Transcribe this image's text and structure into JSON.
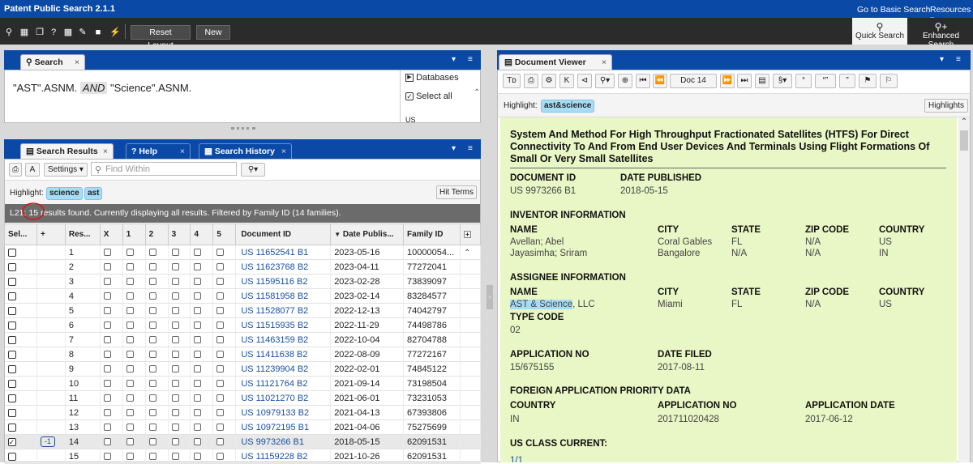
{
  "app": {
    "title": "Patent Public Search 2.1.1",
    "links": [
      "Go to Basic Search",
      "Resources ▾"
    ]
  },
  "toolbar": {
    "reset_layout": "Reset Layout",
    "new": "New",
    "quick_search": "Quick Search",
    "enhanced_search": "Enhanced Search"
  },
  "search_pane": {
    "tab": "Search",
    "query_parts": [
      "\"AST\".ASNM.",
      "AND",
      "\"Science\".ASNM."
    ],
    "databases": "Databases",
    "select_all": "Select all",
    "us": "US"
  },
  "results_pane": {
    "tabs": [
      "Search Results",
      "Help",
      "Search History"
    ],
    "settings": "Settings",
    "find_placeholder": "Find Within",
    "highlight_label": "Highlight:",
    "highlight_terms": [
      "science",
      "ast"
    ],
    "hit_terms": "Hit Terms",
    "status": "L21: 15 results found. Currently displaying all results. Filtered by Family ID (14 families).",
    "columns": [
      "Sel...",
      "+",
      "Res...",
      "X",
      "1",
      "2",
      "3",
      "4",
      "5",
      "Document ID",
      "Date Publis...",
      "Family ID"
    ],
    "rows": [
      {
        "n": "1",
        "doc": "US 11652541 B1",
        "date": "2023-05-16",
        "family": "10000054..."
      },
      {
        "n": "2",
        "doc": "US 11623768 B2",
        "date": "2023-04-11",
        "family": "77272041"
      },
      {
        "n": "3",
        "doc": "US 11595116 B2",
        "date": "2023-02-28",
        "family": "73839097"
      },
      {
        "n": "4",
        "doc": "US 11581958 B2",
        "date": "2023-02-14",
        "family": "83284577"
      },
      {
        "n": "5",
        "doc": "US 11528077 B2",
        "date": "2022-12-13",
        "family": "74042797"
      },
      {
        "n": "6",
        "doc": "US 11515935 B2",
        "date": "2022-11-29",
        "family": "74498786"
      },
      {
        "n": "7",
        "doc": "US 11463159 B2",
        "date": "2022-10-04",
        "family": "82704788"
      },
      {
        "n": "8",
        "doc": "US 11411638 B2",
        "date": "2022-08-09",
        "family": "77272167"
      },
      {
        "n": "9",
        "doc": "US 11239904 B2",
        "date": "2022-02-01",
        "family": "74845122"
      },
      {
        "n": "10",
        "doc": "US 11121764 B2",
        "date": "2021-09-14",
        "family": "73198504"
      },
      {
        "n": "11",
        "doc": "US 11021270 B2",
        "date": "2021-06-01",
        "family": "73231053"
      },
      {
        "n": "12",
        "doc": "US 10979133 B2",
        "date": "2021-04-13",
        "family": "67393806"
      },
      {
        "n": "13",
        "doc": "US 10972195 B1",
        "date": "2021-04-06",
        "family": "75275699"
      },
      {
        "n": "14",
        "doc": "US 9973266 B1",
        "date": "2018-05-15",
        "family": "62091531",
        "badge": "-1"
      },
      {
        "n": "15",
        "doc": "US 11159228 B2",
        "date": "2021-10-26",
        "family": "62091531"
      }
    ]
  },
  "viewer": {
    "tab": "Document Viewer",
    "doc_nav": "Doc 14",
    "highlight_label": "Highlight:",
    "highlight_term": "ast&science",
    "highlights_btn": "Highlights",
    "title": "System And Method For High Throughput Fractionated Satellites (HTFS) For Direct Connectivity To And From End User Devices And Terminals Using Flight Formations Of Small Or Very Small Satellites",
    "document_id_label": "DOCUMENT ID",
    "document_id": "US 9973266 B1",
    "date_published_label": "DATE PUBLISHED",
    "date_published": "2018-05-15",
    "inventor_heading": "INVENTOR INFORMATION",
    "col_name": "NAME",
    "col_city": "CITY",
    "col_state": "STATE",
    "col_zip": "ZIP CODE",
    "col_country": "COUNTRY",
    "inventors": [
      {
        "name": "Avellan; Abel",
        "city": "Coral Gables",
        "state": "FL",
        "zip": "N/A",
        "country": "US"
      },
      {
        "name": "Jayasimha; Sriram",
        "city": "Bangalore",
        "state": "N/A",
        "zip": "N/A",
        "country": "IN"
      }
    ],
    "assignee_heading": "ASSIGNEE INFORMATION",
    "assignee_name_hl": "AST & Science",
    "assignee_name_rest": ", LLC",
    "assignee_city": "Miami",
    "assignee_state": "FL",
    "assignee_zip": "N/A",
    "assignee_country": "US",
    "type_code_label": "TYPE CODE",
    "type_code": "02",
    "application_no_label": "APPLICATION NO",
    "application_no": "15/675155",
    "date_filed_label": "DATE FILED",
    "date_filed": "2017-08-11",
    "foreign_heading": "FOREIGN APPLICATION PRIORITY DATA",
    "f_country_label": "COUNTRY",
    "f_appno_label": "APPLICATION NO",
    "f_appdate_label": "APPLICATION DATE",
    "f_country": "IN",
    "f_appno": "201711020428",
    "f_appdate": "2017-06-12",
    "us_class_heading": "US CLASS CURRENT:",
    "us_class_value": "1/1"
  }
}
